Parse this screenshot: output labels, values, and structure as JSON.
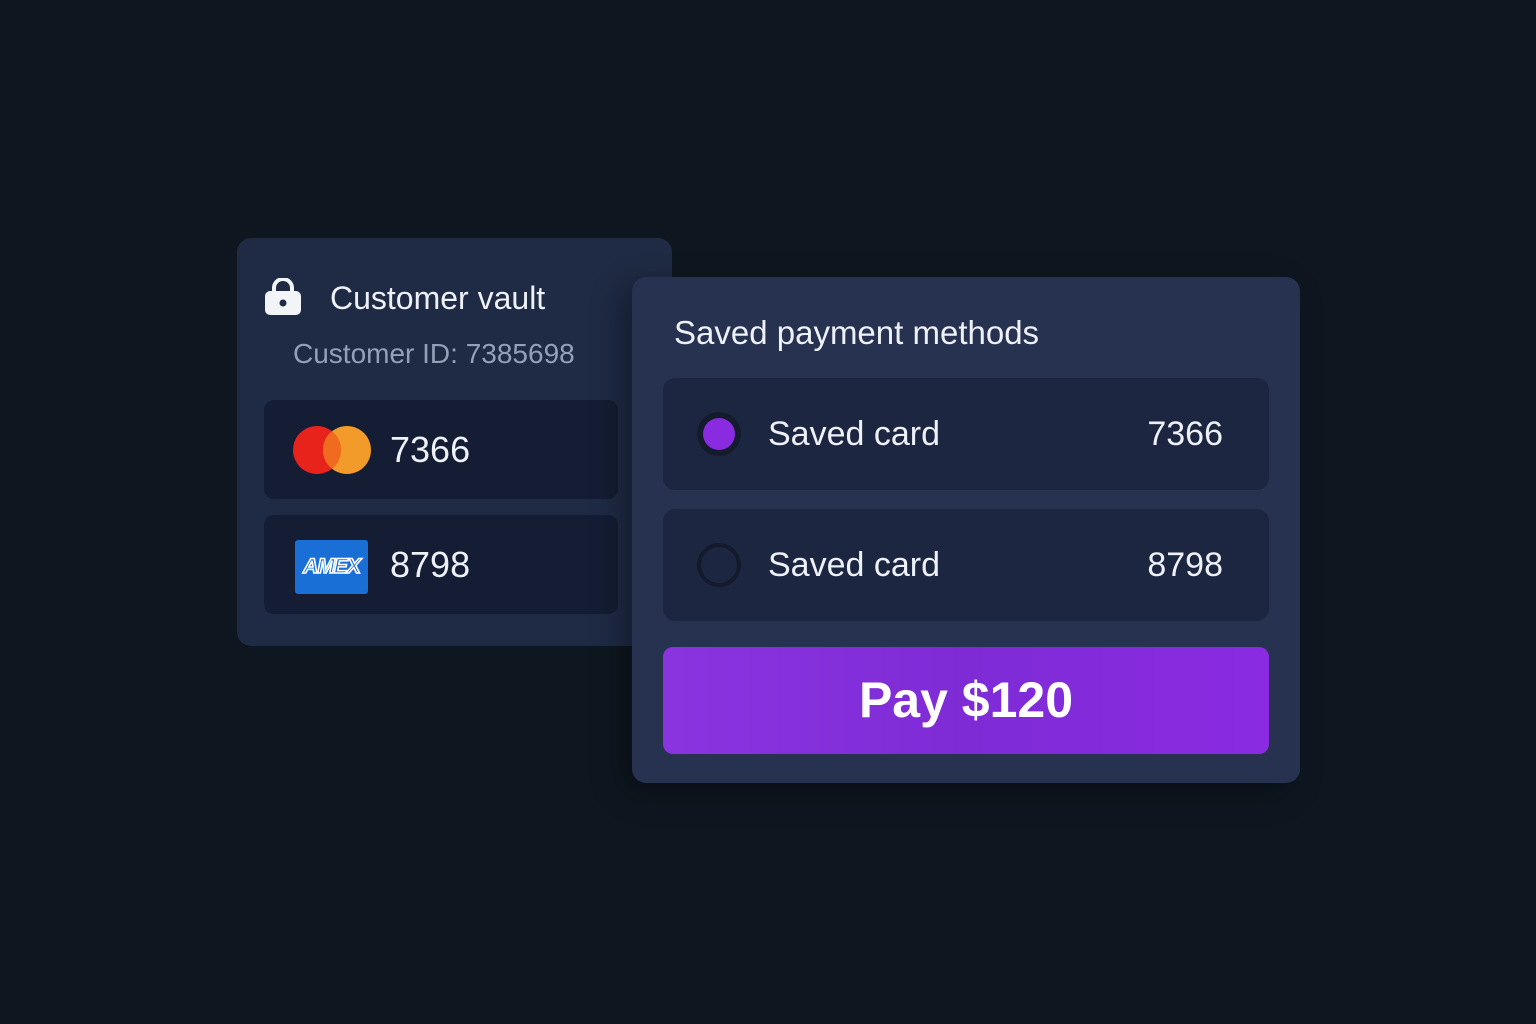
{
  "vault": {
    "title": "Customer vault",
    "customer_id": "Customer ID: 7385698",
    "lock_icon": "lock-icon",
    "cards": [
      {
        "brand": "mastercard",
        "icon": "mastercard-logo-icon",
        "last4": "7366"
      },
      {
        "brand": "amex",
        "icon": "amex-logo-icon",
        "brand_text": "AMEX",
        "last4": "8798"
      }
    ]
  },
  "methods": {
    "title": "Saved payment methods",
    "items": [
      {
        "label": "Saved card",
        "last4": "7366",
        "selected": true
      },
      {
        "label": "Saved card",
        "last4": "8798",
        "selected": false
      }
    ]
  },
  "pay_button": {
    "label": "Pay $120"
  },
  "colors": {
    "background": "#0e1720",
    "card": "#1f2a44",
    "panel": "#273250",
    "row": "#1c2640",
    "accent": "#8a2be2",
    "mastercard_red": "#e8231c",
    "mastercard_orange": "#f39b2a",
    "amex_blue": "#1a6fd6"
  }
}
